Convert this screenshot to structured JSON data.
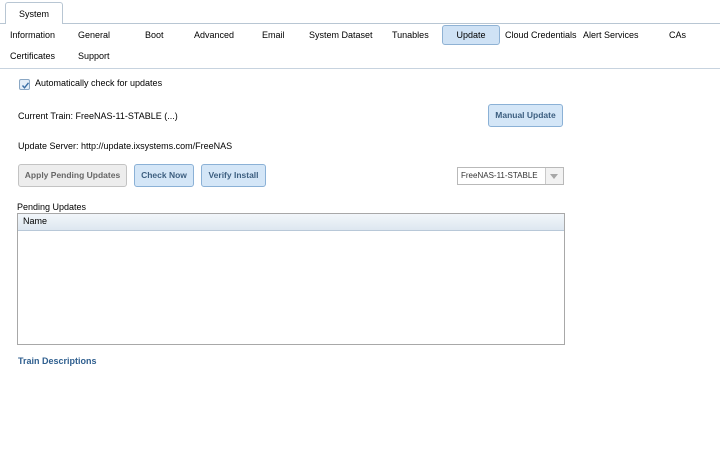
{
  "top_tab": "System",
  "subtabs": [
    "Information",
    "General",
    "Boot",
    "Advanced",
    "Email",
    "System Dataset",
    "Tunables",
    "Update",
    "Cloud Credentials",
    "Alert Services",
    "CAs",
    "Certificates",
    "Support"
  ],
  "active_subtab": "Update",
  "auto_check": {
    "label": "Automatically check for updates",
    "checked": true
  },
  "current_train": "Current Train: FreeNAS-11-STABLE (...)",
  "manual_update": "Manual Update",
  "update_server": "Update Server: http://update.ixsystems.com/FreeNAS",
  "buttons": {
    "apply_pending": "Apply Pending Updates",
    "check_now": "Check Now",
    "verify_install": "Verify Install"
  },
  "train_select": {
    "value": "FreeNAS-11-STABLE"
  },
  "pending": {
    "title": "Pending Updates",
    "column_name": "Name",
    "rows": []
  },
  "train_descriptions_link": "Train Descriptions",
  "colors": {
    "accent": "#cfe2f5",
    "link": "#2f5f8f",
    "button_text": "#3d5f80"
  }
}
